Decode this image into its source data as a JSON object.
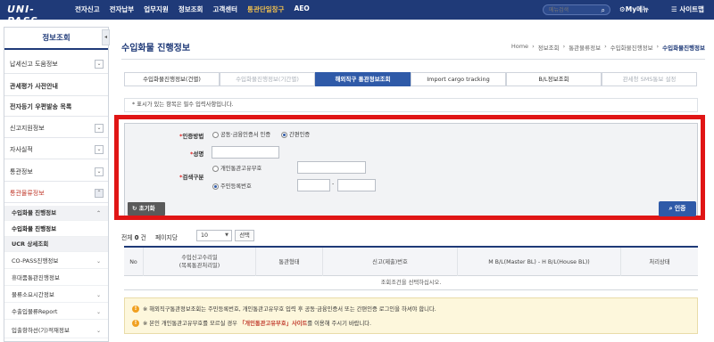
{
  "header": {
    "logo": "UNI-PASS",
    "nav": [
      "전자신고",
      "전자납부",
      "업무지원",
      "정보조회",
      "고객센터",
      "통관단일창구",
      "AEO"
    ],
    "search_placeholder": "메뉴검색",
    "my_menu": "My메뉴",
    "sitemap": "사이트맵"
  },
  "sidebar": {
    "title": "정보조회",
    "items": [
      {
        "label": "납세신고 도움정보"
      },
      {
        "label": "관세평가 사전안내"
      },
      {
        "label": "전자등기 우편발송 목록"
      },
      {
        "label": "신고지원정보"
      },
      {
        "label": "자사실적"
      },
      {
        "label": "통관정보"
      },
      {
        "label": "통관물류정보"
      }
    ],
    "subitems": [
      "수입화물 진행정보",
      "수입화물 진행정보",
      "UCR 상세조회",
      "CO-PASS진행정보",
      "휴대품통관진행정보",
      "물류소요시간정보",
      "수출입물류Report",
      "입출항하선(기)적재정보"
    ]
  },
  "page": {
    "title": "수입화물 진행정보",
    "breadcrumb": [
      "Home",
      "정보조회",
      "통관물류정보",
      "수입화물진행정보",
      "수입화물진행정보"
    ]
  },
  "tabs": [
    "수입화물진행정보(건별)",
    "수입화물진행정보(기간별)",
    "해외직구 통관정보조회",
    "Import cargo tracking",
    "B/L정보조회",
    "관세청 SMS통보 설정"
  ],
  "form": {
    "notice": "* 표시가 있는 항목은 필수 입력사항입니다.",
    "auth_method_label": "인증방법",
    "auth_options": [
      "공동·금융인증서 인증",
      "간편인증"
    ],
    "name_label": "성명",
    "search_type_label": "검색구분",
    "search_options": [
      "개인통관고유부호",
      "주민등록번호"
    ],
    "jumin_separator": "-",
    "reset_label": "초기화",
    "auth_button": "인증"
  },
  "results": {
    "total_label": "전체",
    "total_count": "0",
    "total_unit": "건",
    "per_page_label": "페이지당",
    "per_page_value": "10",
    "select_button": "선택",
    "columns": [
      "No",
      "수입신고수리일\n(목록통관처리일)",
      "통관형태",
      "신고(제출)번호",
      "M B/L(Master BL) - H B/L(House BL))",
      "처리상태"
    ],
    "empty_message": "조회조건을 선택하십시오."
  },
  "warnings": [
    {
      "text": "※ 해외직구통관정보조회는 주민등록번호, 개인통관고유부호 입력 후 공동·금융인증서 또는 간편인증 로그인을 하셔야 합니다."
    },
    {
      "prefix": "※ 본인 개인통관고유부호를 모르실 경우 ",
      "em": "「개인통관고유부호」사이트",
      "suffix": "를 이용해 주시기 바랍니다."
    }
  ],
  "colors": {
    "accent": "#1f3a78",
    "tab_active": "#2f5aa8",
    "highlight": "#e01515"
  }
}
